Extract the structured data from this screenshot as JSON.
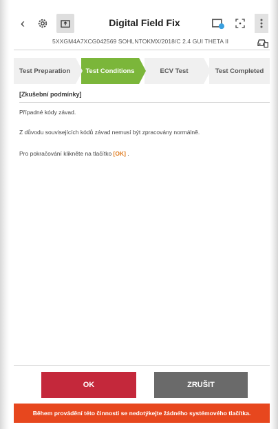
{
  "header": {
    "title": "Digital Field Fix",
    "back_icon": "chevron-left-icon",
    "icons": [
      "gear-icon",
      "upload-icon",
      "cast-icon",
      "scan-icon",
      "more-vertical-icon"
    ]
  },
  "vehicle": {
    "vin_line": "5XXGM4A7XCG042569 SOHLNTOKMX/2018/C 2.4 GUI THETA II"
  },
  "tabs": [
    {
      "label": "Test Preparation",
      "active": false
    },
    {
      "label": "Test Conditions",
      "active": true
    },
    {
      "label": "ECV Test",
      "active": false
    },
    {
      "label": "Test Completed",
      "active": false
    }
  ],
  "content": {
    "section_title": "[Zkušební podmínky]",
    "line1": "Případné kódy závad.",
    "line2": "Z důvodu souvisejících kódů závad nemusí být zpracovány normálně.",
    "line3_prefix": "Pro pokračování klikněte na tlačítko ",
    "line3_ok": "[OK]",
    "line3_suffix": " ."
  },
  "buttons": {
    "ok": "OK",
    "cancel": "ZRUŠIT"
  },
  "warning": "Během provádění této činnosti se nedotýkejte žádného systémového tlačítka.",
  "colors": {
    "active_tab": "#7bb63a",
    "ok_button": "#c4283b",
    "cancel_button": "#6a6a6a",
    "warning_bar": "#e7471e",
    "ok_inline": "#e07a1c"
  }
}
